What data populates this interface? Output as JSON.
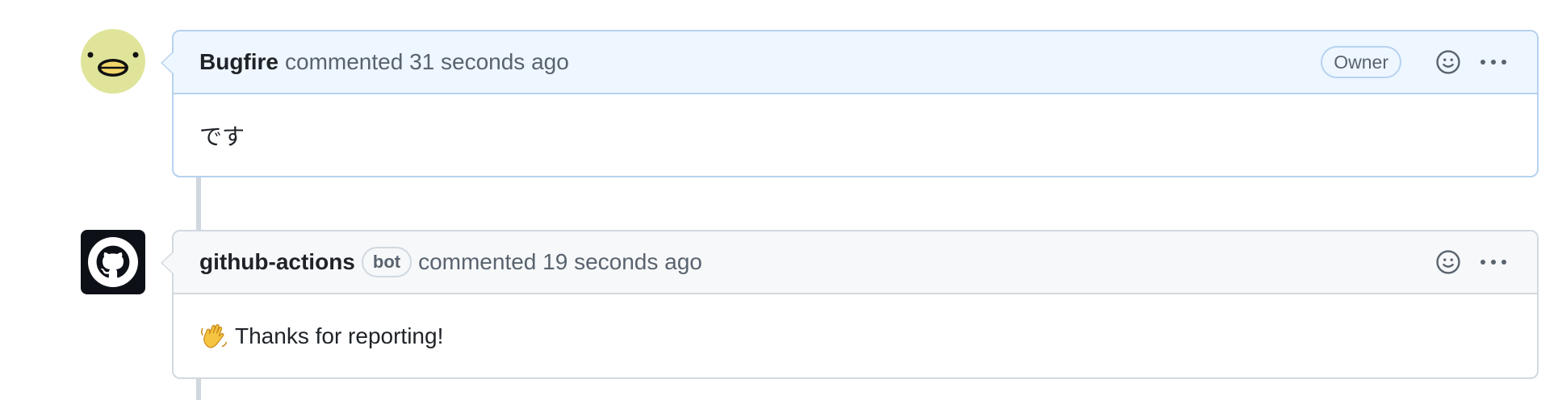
{
  "comments": [
    {
      "author": "Bugfire",
      "meta_text": "commented",
      "time": "31 seconds ago",
      "role_badge": "Owner",
      "body": "です",
      "avatar_icon": "duck-face-avatar",
      "accent_color": "#b6d2f0"
    },
    {
      "author": "github-actions",
      "bot_badge": "bot",
      "meta_text": "commented",
      "time": "19 seconds ago",
      "body": "Thanks for reporting!",
      "body_emoji": "waving-hand-emoji",
      "avatar_icon": "github-octocat-avatar",
      "accent_color": "#d1d9e0"
    }
  ],
  "actions": {
    "reaction_icon": "smiley-icon",
    "menu_icon": "kebab-horizontal-icon"
  }
}
